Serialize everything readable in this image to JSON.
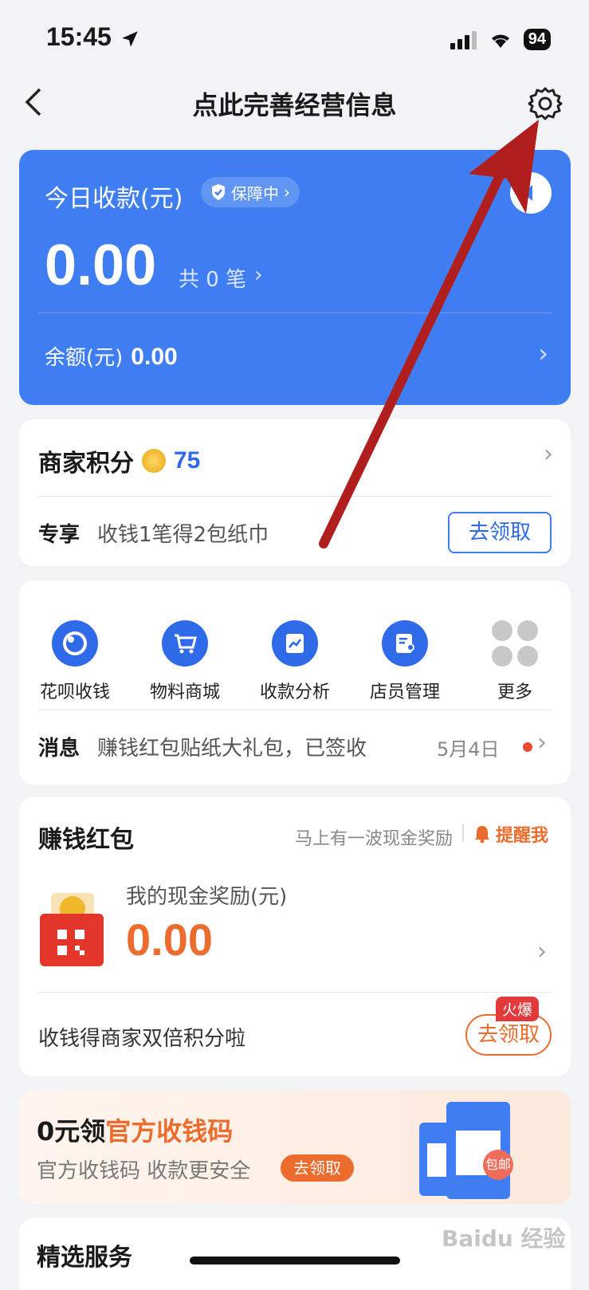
{
  "status": {
    "time": "15:45",
    "battery": "94"
  },
  "nav": {
    "title": "点此完善经营信息"
  },
  "today": {
    "title": "今日收款(元)",
    "badge": "保障中",
    "amount": "0.00",
    "count": "共 0 笔",
    "balance_label": "余额(元)",
    "balance": "0.00"
  },
  "points": {
    "label": "商家积分",
    "value": "75",
    "tag": "专享",
    "text": "收钱1笔得2包纸巾",
    "button": "去领取"
  },
  "shortcuts": {
    "items": [
      {
        "label": "花呗收钱",
        "icon": "huabei-icon"
      },
      {
        "label": "物料商城",
        "icon": "cart-icon"
      },
      {
        "label": "收款分析",
        "icon": "chart-icon"
      },
      {
        "label": "店员管理",
        "icon": "staff-icon"
      },
      {
        "label": "更多",
        "icon": "more-icon"
      }
    ],
    "message_label": "消息",
    "message_text": "赚钱红包贴纸大礼包，已签收",
    "message_date": "5月4日"
  },
  "redpacket": {
    "title": "赚钱红包",
    "hint": "马上有一波现金奖励",
    "remind": "提醒我",
    "reward_label": "我的现金奖励(元)",
    "reward_value": "0.00",
    "promo_text": "收钱得商家双倍积分啦",
    "hot_badge": "火爆",
    "promo_button": "去领取"
  },
  "qrcode": {
    "title_prefix": "0元领",
    "title_highlight": "官方收钱码",
    "subtitle": "官方收钱码 收款更安全",
    "button": "去领取",
    "stand_badge": "包邮"
  },
  "selected": {
    "title": "精选服务"
  },
  "watermark": "Baidu 经验",
  "colors": {
    "primary": "#3f7ef2",
    "orange": "#ec6c2e",
    "red_arrow": "#b01e1e"
  }
}
